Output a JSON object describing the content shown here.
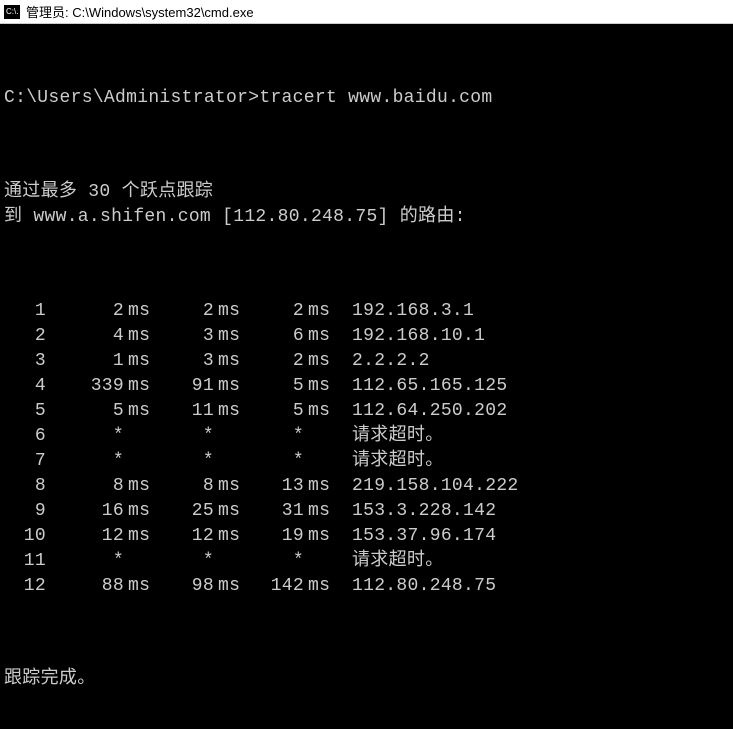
{
  "titlebar": {
    "icon_text": "C:\\.",
    "title": "管理员: C:\\Windows\\system32\\cmd.exe"
  },
  "prompt": {
    "path": "C:\\Users\\Administrator>",
    "command": "tracert www.baidu.com"
  },
  "info": {
    "line1": "通过最多 30 个跃点跟踪",
    "line2": "到 www.a.shifen.com [112.80.248.75] 的路由:"
  },
  "hops": [
    {
      "n": "1",
      "t1": "2",
      "u1": "ms",
      "t2": "2",
      "u2": "ms",
      "t3": "2",
      "u3": "ms",
      "host": "192.168.3.1"
    },
    {
      "n": "2",
      "t1": "4",
      "u1": "ms",
      "t2": "3",
      "u2": "ms",
      "t3": "6",
      "u3": "ms",
      "host": "192.168.10.1"
    },
    {
      "n": "3",
      "t1": "1",
      "u1": "ms",
      "t2": "3",
      "u2": "ms",
      "t3": "2",
      "u3": "ms",
      "host": "2.2.2.2"
    },
    {
      "n": "4",
      "t1": "339",
      "u1": "ms",
      "t2": "91",
      "u2": "ms",
      "t3": "5",
      "u3": "ms",
      "host": "112.65.165.125"
    },
    {
      "n": "5",
      "t1": "5",
      "u1": "ms",
      "t2": "11",
      "u2": "ms",
      "t3": "5",
      "u3": "ms",
      "host": "112.64.250.202"
    },
    {
      "n": "6",
      "t1": "*",
      "u1": "",
      "t2": "*",
      "u2": "",
      "t3": "*",
      "u3": "",
      "host": "请求超时。"
    },
    {
      "n": "7",
      "t1": "*",
      "u1": "",
      "t2": "*",
      "u2": "",
      "t3": "*",
      "u3": "",
      "host": "请求超时。"
    },
    {
      "n": "8",
      "t1": "8",
      "u1": "ms",
      "t2": "8",
      "u2": "ms",
      "t3": "13",
      "u3": "ms",
      "host": "219.158.104.222"
    },
    {
      "n": "9",
      "t1": "16",
      "u1": "ms",
      "t2": "25",
      "u2": "ms",
      "t3": "31",
      "u3": "ms",
      "host": "153.3.228.142"
    },
    {
      "n": "10",
      "t1": "12",
      "u1": "ms",
      "t2": "12",
      "u2": "ms",
      "t3": "19",
      "u3": "ms",
      "host": "153.37.96.174"
    },
    {
      "n": "11",
      "t1": "*",
      "u1": "",
      "t2": "*",
      "u2": "",
      "t3": "*",
      "u3": "",
      "host": "请求超时。"
    },
    {
      "n": "12",
      "t1": "88",
      "u1": "ms",
      "t2": "98",
      "u2": "ms",
      "t3": "142",
      "u3": "ms",
      "host": "112.80.248.75"
    }
  ],
  "complete": "跟踪完成。"
}
